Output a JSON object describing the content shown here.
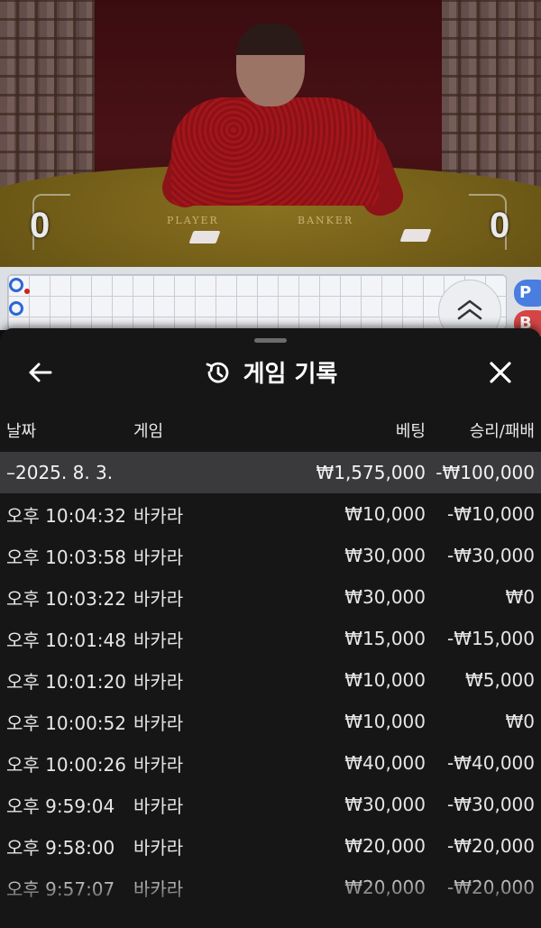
{
  "video": {
    "player_label": "PLAYER",
    "banker_label": "BANKER",
    "player_score": "0",
    "banker_score": "0"
  },
  "roadmap": {
    "badges": [
      "P",
      "B"
    ]
  },
  "sheet": {
    "title": "게임 기록",
    "columns": {
      "date": "날짜",
      "game": "게임",
      "bet": "베팅",
      "win_loss": "승리/패배"
    },
    "summary": {
      "date": "–2025. 8. 3.",
      "bet": "₩1,575,000",
      "win_loss": "-₩100,000"
    },
    "rows": [
      {
        "time": "오후 10:04:32",
        "game": "바카라",
        "bet": "₩10,000",
        "result": "-₩10,000"
      },
      {
        "time": "오후 10:03:58",
        "game": "바카라",
        "bet": "₩30,000",
        "result": "-₩30,000"
      },
      {
        "time": "오후 10:03:22",
        "game": "바카라",
        "bet": "₩30,000",
        "result": "₩0"
      },
      {
        "time": "오후 10:01:48",
        "game": "바카라",
        "bet": "₩15,000",
        "result": "-₩15,000"
      },
      {
        "time": "오후 10:01:20",
        "game": "바카라",
        "bet": "₩10,000",
        "result": "₩5,000"
      },
      {
        "time": "오후 10:00:52",
        "game": "바카라",
        "bet": "₩10,000",
        "result": "₩0"
      },
      {
        "time": "오후 10:00:26",
        "game": "바카라",
        "bet": "₩40,000",
        "result": "-₩40,000"
      },
      {
        "time": "오후 9:59:04",
        "game": "바카라",
        "bet": "₩30,000",
        "result": "-₩30,000"
      },
      {
        "time": "오후 9:58:00",
        "game": "바카라",
        "bet": "₩20,000",
        "result": "-₩20,000"
      },
      {
        "time": "오후 9:57:07",
        "game": "바카라",
        "bet": "₩20,000",
        "result": "-₩20,000"
      }
    ]
  }
}
